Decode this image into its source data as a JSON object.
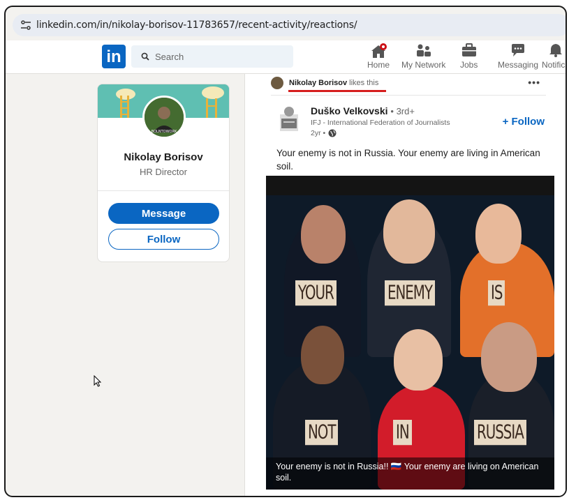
{
  "browser": {
    "url": "linkedin.com/in/nikolay-borisov-11783657/recent-activity/reactions/"
  },
  "nav": {
    "search_placeholder": "Search",
    "items": [
      {
        "label": "Home"
      },
      {
        "label": "My Network"
      },
      {
        "label": "Jobs"
      },
      {
        "label": "Messaging"
      },
      {
        "label": "Notifica"
      }
    ]
  },
  "profile": {
    "name": "Nikolay Borisov",
    "title": "HR Director",
    "message_label": "Message",
    "follow_label": "Follow",
    "avatar_text": "BOLNTOWORK"
  },
  "post": {
    "liker": "Nikolay Borisov",
    "action": "likes this",
    "author_name": "Duško Velkovski",
    "author_degree": "• 3rd+",
    "author_headline": "IFJ - International Federation of Journalists",
    "age": "2yr •",
    "follow_label": "+ Follow",
    "text": "Your enemy is not in Russia. Your enemy are living in American soil.",
    "image_words": [
      "YOUR",
      "ENEMY",
      "IS",
      "NOT",
      "IN",
      "RUSSIA"
    ],
    "image_caption": "Your enemy is not in Russia!! 🇷🇺 Your enemy are living on American soil."
  }
}
